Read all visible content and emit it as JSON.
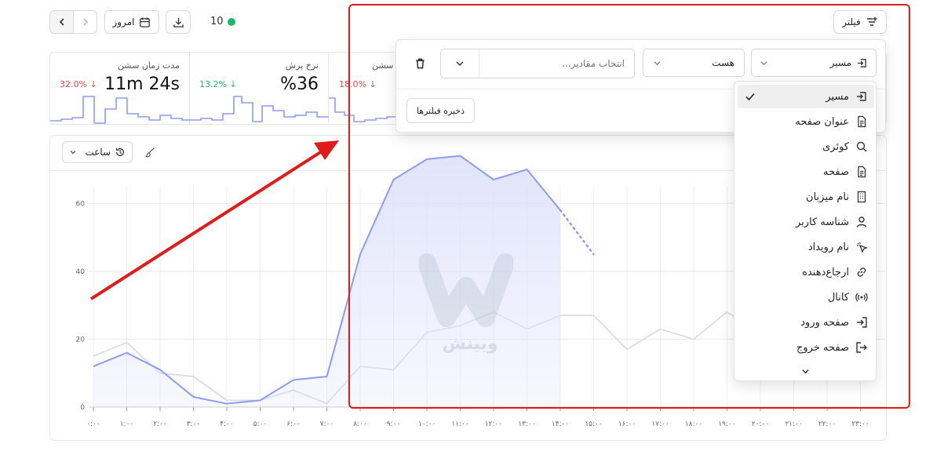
{
  "toolbar": {
    "today_label": "امروز",
    "online_count": "10",
    "filter_label": "فیلتر"
  },
  "stats": [
    {
      "title": "مدت زمان سشن",
      "value": "11m 24s",
      "delta": "32.0%",
      "trend": "down",
      "color": "#e5484d"
    },
    {
      "title": "نرخ پرش",
      "value": "%36",
      "delta": "13.2%",
      "trend": "down",
      "color": "#1fb86a"
    },
    {
      "title": "سشن",
      "value": "",
      "delta": "18.0%",
      "trend": "down",
      "color": "#e5484d"
    }
  ],
  "chart_toolbar": {
    "interval_label": "ساعت"
  },
  "filter_panel": {
    "field_value": "مسیر",
    "operator_value": "هست",
    "values_placeholder": "انتخاب مقادیر...",
    "save_label": "ذخیره فیلترها"
  },
  "field_menu": {
    "items": [
      {
        "label": "مسیر",
        "icon": "enter-icon",
        "selected": true
      },
      {
        "label": "عنوان صفحه",
        "icon": "document-icon",
        "selected": false
      },
      {
        "label": "کوئری",
        "icon": "search-icon",
        "selected": false
      },
      {
        "label": "صفحه",
        "icon": "document-icon",
        "selected": false
      },
      {
        "label": "نام میزبان",
        "icon": "building-icon",
        "selected": false
      },
      {
        "label": "شناسه کاربر",
        "icon": "user-icon",
        "selected": false
      },
      {
        "label": "نام رویداد",
        "icon": "pointer-click-icon",
        "selected": false
      },
      {
        "label": "ارجاع‌دهنده",
        "icon": "link-icon",
        "selected": false
      },
      {
        "label": "کانال",
        "icon": "broadcast-icon",
        "selected": false
      },
      {
        "label": "صفحه ورود",
        "icon": "login-icon",
        "selected": false
      },
      {
        "label": "صفحه خروج",
        "icon": "logout-icon",
        "selected": false
      }
    ]
  },
  "watermark": "وبینش",
  "colors": {
    "accent": "#8e9cf0",
    "accent_fill": "#dfe3fb",
    "compare_line": "#dcdcdc",
    "annotation": "#e11a1a",
    "online": "#1fb86a"
  },
  "chart_data": {
    "type": "line",
    "x": [
      "۰:۰۰",
      "۱:۰۰",
      "۲:۰۰",
      "۳:۰۰",
      "۴:۰۰",
      "۵:۰۰",
      "۶:۰۰",
      "۷:۰۰",
      "۸:۰۰",
      "۹:۰۰",
      "۱۰:۰۰",
      "۱۱:۰۰",
      "۱۲:۰۰",
      "۱۳:۰۰",
      "۱۴:۰۰",
      "۱۵:۰۰",
      "۱۶:۰۰",
      "۱۷:۰۰",
      "۱۸:۰۰",
      "۱۹:۰۰",
      "۲۰:۰۰",
      "۲۱:۰۰",
      "۲۲:۰۰",
      "۲۳:۰۰"
    ],
    "ylim": [
      0,
      70
    ],
    "yticks": [
      0,
      20,
      40,
      60
    ],
    "series": [
      {
        "values": [
          12,
          16,
          11,
          3,
          1,
          2,
          8,
          9,
          45,
          67,
          73,
          74,
          67,
          70,
          58,
          45,
          null,
          null,
          null,
          null,
          null,
          null,
          null,
          null
        ]
      },
      {
        "values": [
          15,
          19,
          10,
          9,
          2,
          2,
          5,
          1,
          12,
          11,
          22,
          24,
          28,
          23,
          27,
          27,
          17,
          23,
          20,
          28,
          22,
          null,
          null,
          null
        ]
      }
    ]
  }
}
